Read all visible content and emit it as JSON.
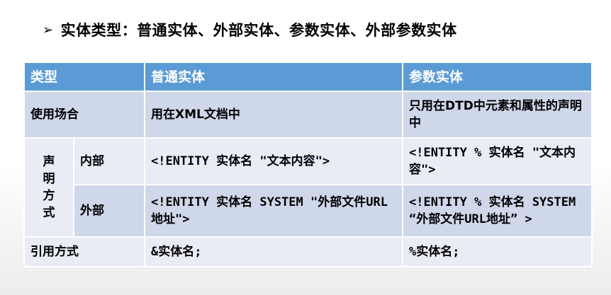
{
  "heading": {
    "bullet": "➢",
    "text": "实体类型：普通实体、外部实体、参数实体、外部参数实体"
  },
  "table": {
    "headers": [
      "类型",
      "普通实体",
      "参数实体"
    ],
    "usage": {
      "label": "使用场合",
      "normal": "用在XML文档中",
      "param": "只用在DTD中元素和属性的声明中"
    },
    "declaration": {
      "label_chars": [
        "声",
        "明",
        "方",
        "式"
      ],
      "internal": {
        "label": "内部",
        "normal": "<!ENTITY 实体名 \"文本内容\">",
        "param": "<!ENTITY % 实体名 \"文本内容\">"
      },
      "external": {
        "label": "外部",
        "normal": "<!ENTITY 实体名 SYSTEM \"外部文件URL地址\">",
        "param": "<!ENTITY % 实体名 SYSTEM “外部文件URL地址” >"
      }
    },
    "reference": {
      "label": "引用方式",
      "normal": "&实体名;",
      "param": "%实体名;"
    }
  }
}
